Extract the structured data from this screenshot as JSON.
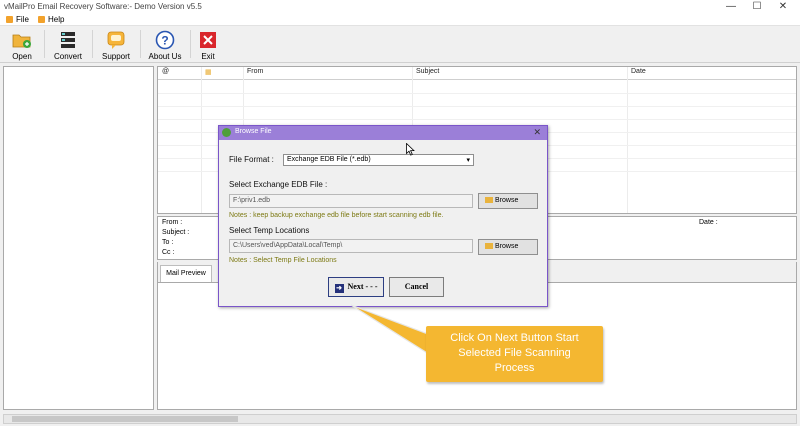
{
  "window": {
    "title": "vMailPro Email Recovery Software:- Demo Version v5.5",
    "controls": [
      "—",
      "☐",
      "✕"
    ]
  },
  "menu": [
    {
      "label": "File"
    },
    {
      "label": "Help"
    }
  ],
  "toolbar": [
    {
      "label": "Open",
      "icon": "open-folder-icon"
    },
    {
      "label": "Convert",
      "icon": "convert-icon"
    },
    {
      "label": "Support",
      "icon": "support-icon"
    },
    {
      "label": "About Us",
      "icon": "help-icon"
    },
    {
      "label": "Exit",
      "icon": "exit-icon"
    }
  ],
  "grid": {
    "columns": [
      "@",
      "",
      "From",
      "Subject",
      "Date"
    ]
  },
  "details": {
    "from_label": "From :",
    "subject_label": "Subject :",
    "to_label": "To :",
    "cc_label": "Cc :",
    "date_label": "Date :"
  },
  "preview": {
    "tab_label": "Mail Preview"
  },
  "dialog": {
    "title": "Browse File",
    "file_format_label": "File Format :",
    "file_format_value": "Exchange EDB File (*.edb)",
    "edb_section_label": "Select Exchange EDB File :",
    "edb_path": "F:\\priv1.edb",
    "edb_note": "Notes : keep backup exchange edb file before start scanning edb file.",
    "browse_label": "Browse",
    "temp_section_label": "Select Temp Locations",
    "temp_path": "C:\\Users\\ved\\AppData\\Local\\Temp\\",
    "temp_note": "Notes : Select Temp File Locations",
    "next_label": "Next - - -",
    "cancel_label": "Cancel"
  },
  "callout": {
    "line1": "Click On Next Button Start",
    "line2": "Selected File Scanning",
    "line3": "Process"
  },
  "colors": {
    "dialog_title": "#9b7fd8",
    "callout": "#f4b731",
    "note_text": "#7d7a14"
  }
}
